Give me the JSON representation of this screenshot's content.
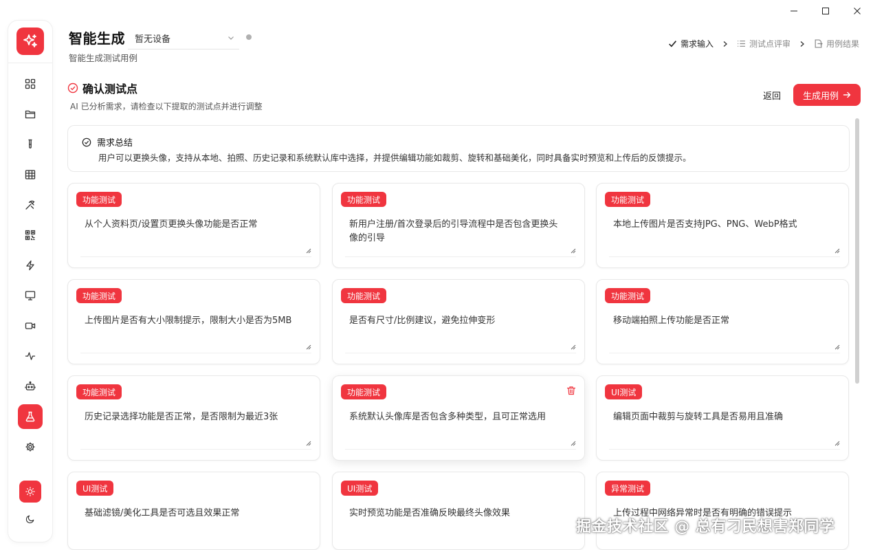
{
  "window": {
    "min_icon": "minimize-icon",
    "max_icon": "maximize-icon",
    "close_icon": "close-icon"
  },
  "sidebar": {
    "logo_icon": "sparkle-icon",
    "items": [
      {
        "icon": "dashboard-icon"
      },
      {
        "icon": "folder-icon"
      },
      {
        "icon": "test-tube-icon"
      },
      {
        "icon": "table-icon"
      },
      {
        "icon": "tools-icon"
      },
      {
        "icon": "qrcode-icon"
      },
      {
        "icon": "lightning-icon"
      },
      {
        "icon": "monitor-icon"
      },
      {
        "icon": "video-icon"
      },
      {
        "icon": "activity-icon"
      },
      {
        "icon": "robot-icon"
      },
      {
        "icon": "flask-icon",
        "active": true
      },
      {
        "icon": "gear-icon"
      }
    ],
    "theme_light_icon": "sun-icon",
    "theme_dark_icon": "moon-icon"
  },
  "header": {
    "title": "智能生成",
    "subtitle": "智能生成测试用例",
    "device_value": "暂无设备"
  },
  "steps": [
    {
      "label": "需求输入",
      "state": "done",
      "icon": "check-icon"
    },
    {
      "label": "测试点评审",
      "state": "todo",
      "icon": "list-icon"
    },
    {
      "label": "用例结果",
      "state": "todo",
      "icon": "file-export-icon"
    }
  ],
  "section": {
    "title": "确认测试点",
    "description": "AI 已分析需求，请检查以下提取的测试点并进行调整",
    "back_label": "返回",
    "generate_label": "生成用例"
  },
  "summary": {
    "label": "需求总结",
    "text": "用户可以更换头像，支持从本地、拍照、历史记录和系统默认库中选择，并提供编辑功能如裁剪、旋转和基础美化，同时具备实时预览和上传后的反馈提示。"
  },
  "cards": [
    {
      "tag": "功能测试",
      "text": "从个人资料页/设置页更换头像功能是否正常"
    },
    {
      "tag": "功能测试",
      "text": "新用户注册/首次登录后的引导流程中是否包含更换头像的引导"
    },
    {
      "tag": "功能测试",
      "text": "本地上传图片是否支持JPG、PNG、WebP格式"
    },
    {
      "tag": "功能测试",
      "text": "上传图片是否有大小限制提示，限制大小是否为5MB"
    },
    {
      "tag": "功能测试",
      "text": "是否有尺寸/比例建议，避免拉伸变形"
    },
    {
      "tag": "功能测试",
      "text": "移动端拍照上传功能是否正常"
    },
    {
      "tag": "功能测试",
      "text": "历史记录选择功能是否正常，是否限制为最近3张"
    },
    {
      "tag": "功能测试",
      "text": "系统默认头像库是否包含多种类型，且可正常选用",
      "hover": true
    },
    {
      "tag": "UI测试",
      "text": "编辑页面中裁剪与旋转工具是否易用且准确"
    },
    {
      "tag": "UI测试",
      "text": "基础滤镜/美化工具是否可选且效果正常"
    },
    {
      "tag": "UI测试",
      "text": "实时预览功能是否准确反映最终头像效果"
    },
    {
      "tag": "异常测试",
      "text": "上传过程中网络异常时是否有明确的错误提示"
    }
  ],
  "watermark": "掘金技术社区 @ 总有刁民想害郑同学",
  "colors": {
    "accent": "#f0353f"
  }
}
